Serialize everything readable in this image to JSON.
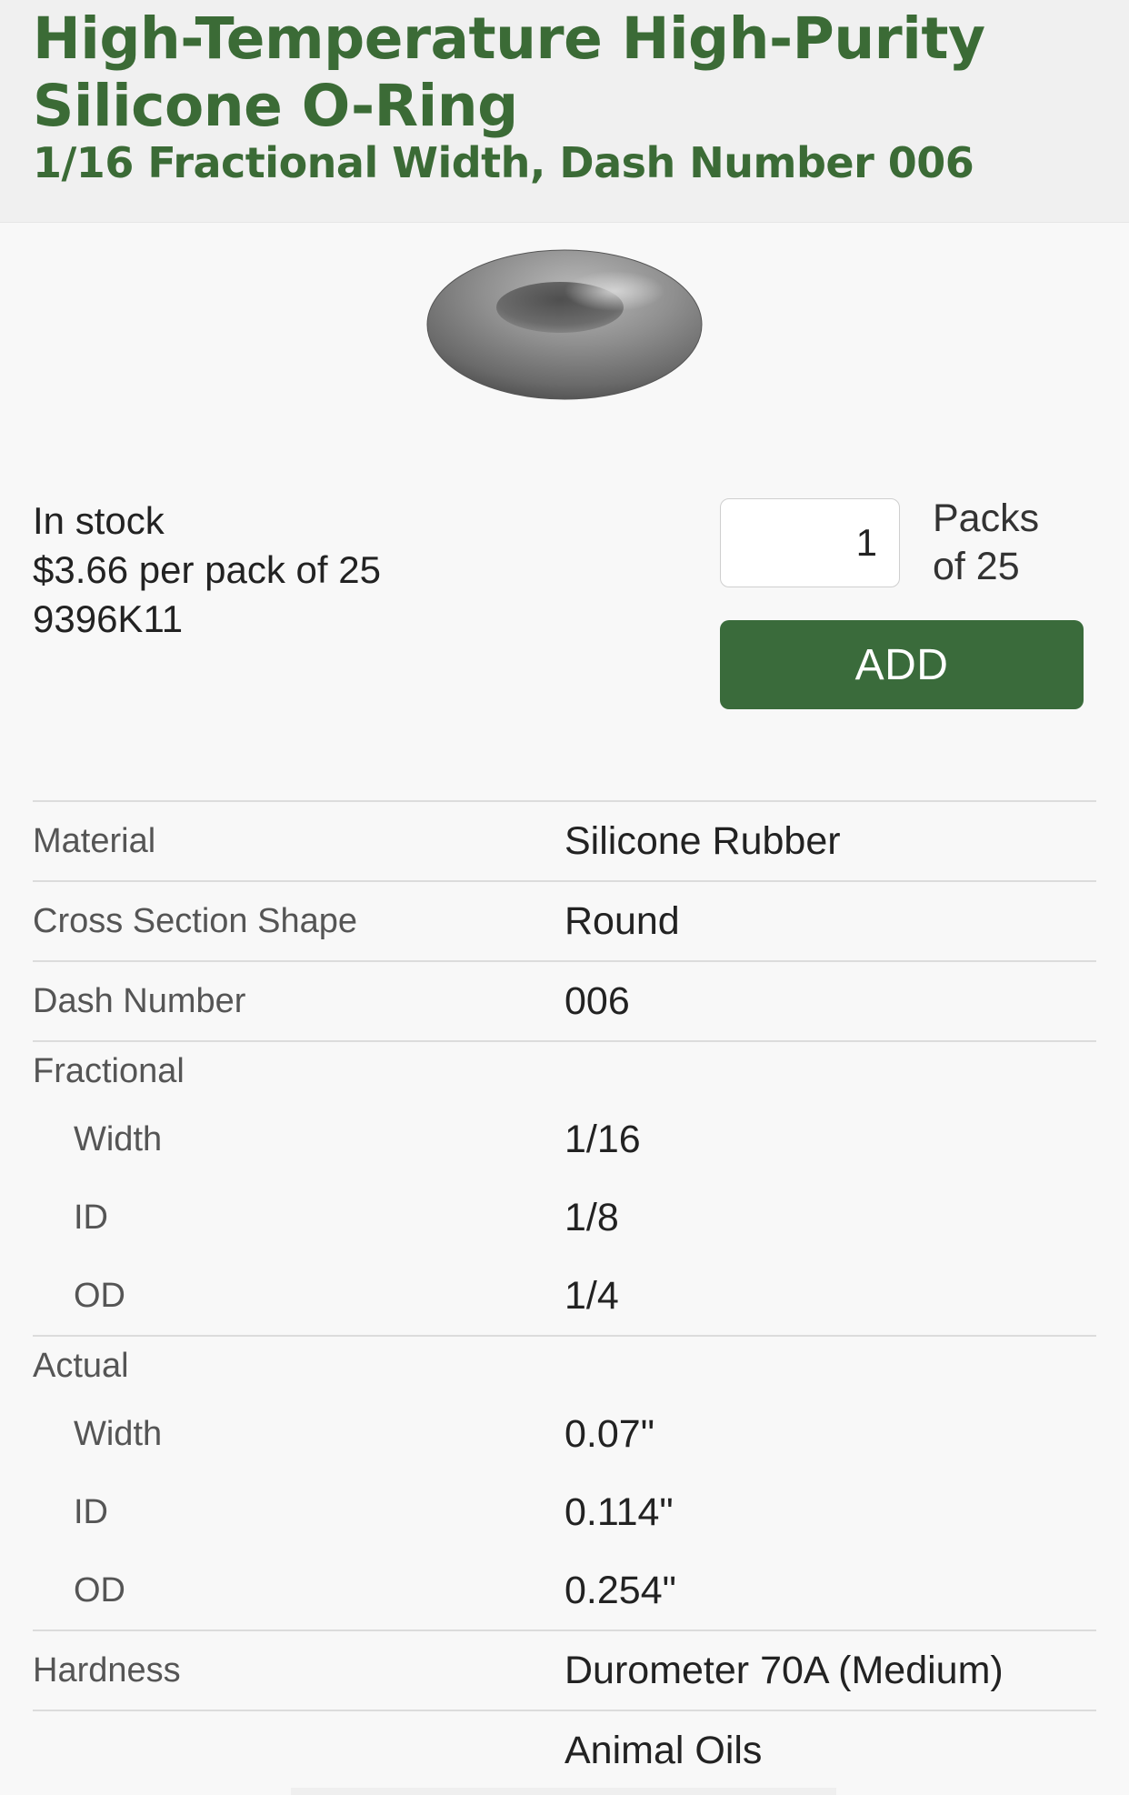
{
  "header": {
    "title": "High-Temperature High-Purity Silicone O-Ring",
    "subtitle": "1/16 Fractional Width, Dash Number 006"
  },
  "product": {
    "image_icon": "o-ring-image",
    "stock_status": "In stock",
    "price_text": "$3.66 per pack of 25",
    "part_number": "9396K11"
  },
  "order": {
    "quantity": "1",
    "unit_line1": "Packs",
    "unit_line2": "of 25",
    "add_label": "ADD"
  },
  "specs": {
    "material": {
      "label": "Material",
      "value": "Silicone Rubber"
    },
    "cross_section": {
      "label": "Cross Section Shape",
      "value": "Round"
    },
    "dash_number": {
      "label": "Dash Number",
      "value": "006"
    },
    "fractional": {
      "title": "Fractional",
      "rows": [
        {
          "label": "Width",
          "value": "1/16"
        },
        {
          "label": "ID",
          "value": "1/8"
        },
        {
          "label": "OD",
          "value": "1/4"
        }
      ]
    },
    "actual": {
      "title": "Actual",
      "rows": [
        {
          "label": "Width",
          "value": "0.07\""
        },
        {
          "label": "ID",
          "value": "0.114\""
        },
        {
          "label": "OD",
          "value": "0.254\""
        }
      ]
    },
    "hardness": {
      "label": "Hardness",
      "value": "Durometer 70A (Medium)"
    },
    "chemical_resistance": {
      "label": "",
      "value": "Animal Oils"
    }
  },
  "colors": {
    "brand_green": "#3b6b36",
    "button_green": "#3a6b3b"
  }
}
